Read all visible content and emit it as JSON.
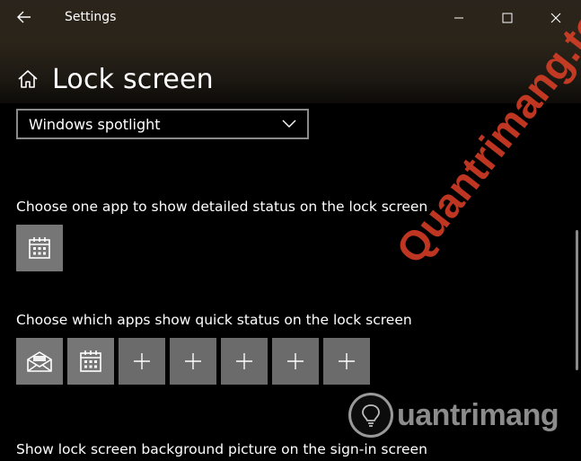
{
  "window": {
    "title": "Settings"
  },
  "header": {
    "title": "Lock screen"
  },
  "background": {
    "dropdown_value": "Windows spotlight"
  },
  "detailed_status": {
    "label": "Choose one app to show detailed status on the lock screen",
    "app_icon": "calendar-icon"
  },
  "quick_status": {
    "label": "Choose which apps show quick status on the lock screen",
    "apps": [
      "mail-icon",
      "calendar-icon"
    ],
    "empty_slots": 5
  },
  "signin": {
    "label": "Show lock screen background picture on the sign-in screen"
  },
  "watermark": {
    "top": "Quantrimang",
    "bottom": "uantrimang",
    "diagonal": ".top"
  },
  "colors": {
    "background": "#000000",
    "tile": "#6b6b6b",
    "watermark_red": "#e84228"
  }
}
